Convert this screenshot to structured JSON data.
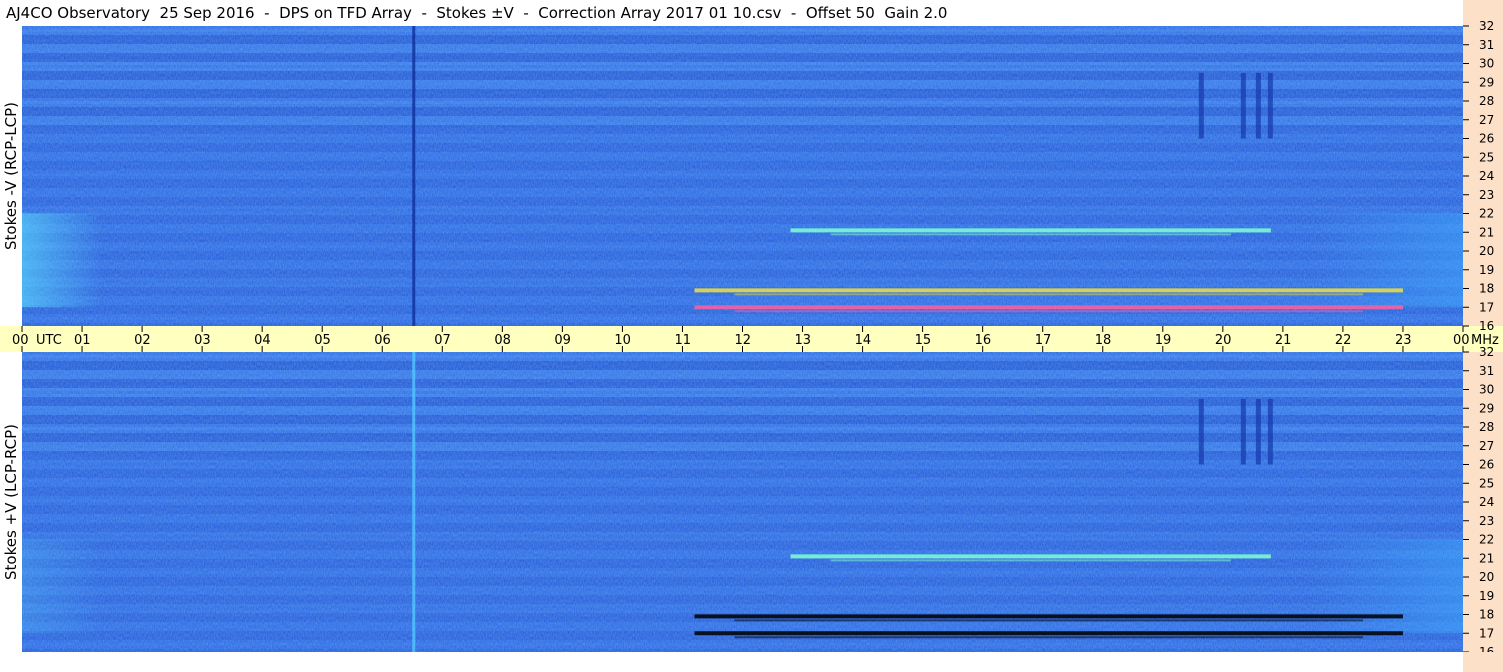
{
  "title": "AJ4CO Observatory  25 Sep 2016  -  DPS on TFD Array  -  Stokes ±V  -  Correction Array 2017 01 10.csv  -  Offset 50  Gain 2.0",
  "colors": {
    "background_blue": "#1f5fe0",
    "band_light": "#3a86f0",
    "band_dark": "#174bc8",
    "axis_panel": "#fde0c8",
    "utc_strip": "#ffffc0"
  },
  "chart_data": [
    {
      "type": "heatmap",
      "panel": "top",
      "ylabel": "Stokes -V (RCP-LCP)",
      "x_label": "UTC",
      "x_ticks": [
        "00",
        "01",
        "02",
        "03",
        "04",
        "05",
        "06",
        "07",
        "08",
        "09",
        "10",
        "11",
        "12",
        "13",
        "14",
        "15",
        "16",
        "17",
        "18",
        "19",
        "20",
        "21",
        "22",
        "23",
        "00"
      ],
      "xlim": [
        0,
        24
      ],
      "y_unit": "MHz",
      "y_ticks": [
        "16",
        "17",
        "18",
        "19",
        "20",
        "21",
        "22",
        "23",
        "24",
        "25",
        "26",
        "27",
        "28",
        "29",
        "30",
        "31",
        "32"
      ],
      "ylim": [
        16,
        32
      ],
      "features": [
        {
          "kind": "horizontal_emission",
          "utc_start": 11.2,
          "utc_end": 23.0,
          "mhz": 17.9,
          "color": "#f0e040"
        },
        {
          "kind": "horizontal_emission",
          "utc_start": 11.2,
          "utc_end": 23.0,
          "mhz": 17.0,
          "color": "#ff60a0"
        },
        {
          "kind": "horizontal_emission",
          "utc_start": 12.8,
          "utc_end": 20.8,
          "mhz": 21.1,
          "color": "#7fffd0"
        },
        {
          "kind": "vertical_interference",
          "utc": 6.5
        }
      ]
    },
    {
      "type": "heatmap",
      "panel": "bottom",
      "ylabel": "Stokes +V (LCP-RCP)",
      "y_unit": "MHz",
      "y_ticks": [
        "16",
        "17",
        "18",
        "19",
        "20",
        "21",
        "22",
        "23",
        "24",
        "25",
        "26",
        "27",
        "28",
        "29",
        "30",
        "31",
        "32"
      ],
      "ylim": [
        16,
        32
      ],
      "xlim": [
        0,
        24
      ],
      "features": [
        {
          "kind": "horizontal_absorption",
          "utc_start": 11.2,
          "utc_end": 23.0,
          "mhz": 17.9,
          "color": "#000000"
        },
        {
          "kind": "horizontal_absorption",
          "utc_start": 11.2,
          "utc_end": 23.0,
          "mhz": 17.0,
          "color": "#000000"
        },
        {
          "kind": "horizontal_emission",
          "utc_start": 12.8,
          "utc_end": 20.8,
          "mhz": 21.1,
          "color": "#7fffd0"
        },
        {
          "kind": "vertical_interference",
          "utc": 6.5
        }
      ]
    }
  ]
}
